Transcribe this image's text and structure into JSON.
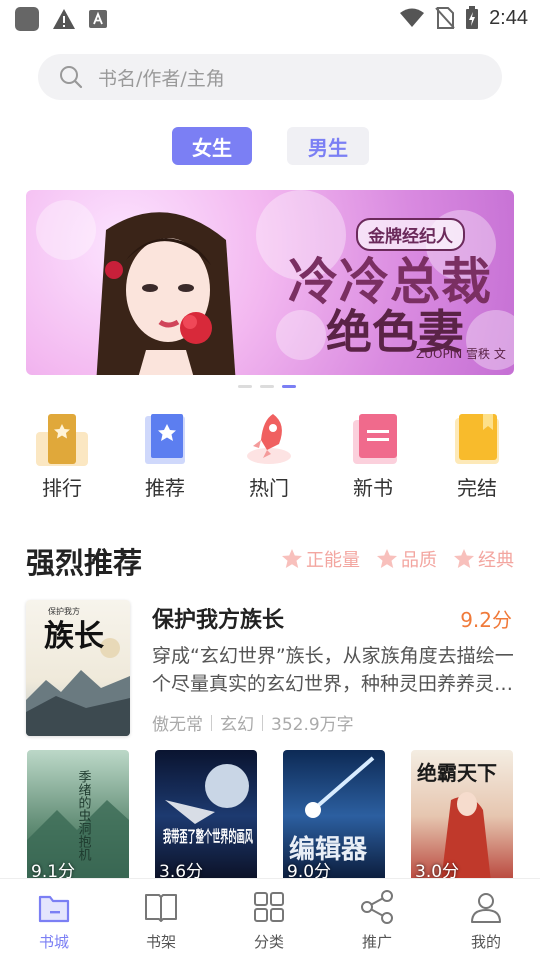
{
  "status_bar": {
    "time": "2:44"
  },
  "search": {
    "placeholder": "书名/作者/主角"
  },
  "tabs": [
    {
      "label": "女生",
      "active": true
    },
    {
      "label": "男生",
      "active": false
    }
  ],
  "banner": {
    "tag": "金牌经纪人",
    "title_line1": "冷冷总裁",
    "title_line2": "绝色妻",
    "author": "ZUOPIN 雪秩 文",
    "page_count": 3,
    "active_page": 3
  },
  "categories": [
    {
      "label": "排行",
      "icon": "ranking-icon"
    },
    {
      "label": "推荐",
      "icon": "recommend-icon"
    },
    {
      "label": "热门",
      "icon": "rocket-icon"
    },
    {
      "label": "新书",
      "icon": "new-book-icon"
    },
    {
      "label": "完结",
      "icon": "finished-icon"
    }
  ],
  "section": {
    "title": "强烈推荐",
    "tags": [
      "正能量",
      "品质",
      "经典"
    ]
  },
  "featured": {
    "title": "保护我方族长",
    "score": "9.2分",
    "description": "穿成“玄幻世界”族长，从家族角度去描绘一个尽量真实的玄幻世界，种种灵田养养灵…",
    "author": "傲无常",
    "genre": "玄幻",
    "word_count": "352.9万字",
    "cover_text": "族长",
    "cover_subtitle": "保护我方"
  },
  "books": [
    {
      "score": "9.1分",
      "cover_text": "季绪的虫洞抱机"
    },
    {
      "score": "3.6分",
      "cover_text": "我带歪了整个世界的画风"
    },
    {
      "score": "9.0分",
      "cover_text": "编辑器"
    },
    {
      "score": "3.0分",
      "cover_text": "绝霸天下"
    }
  ],
  "bottom_nav": [
    {
      "label": "书城",
      "icon": "bookstore-icon",
      "active": true
    },
    {
      "label": "书架",
      "icon": "bookshelf-icon",
      "active": false
    },
    {
      "label": "分类",
      "icon": "category-grid-icon",
      "active": false
    },
    {
      "label": "推广",
      "icon": "share-icon",
      "active": false
    },
    {
      "label": "我的",
      "icon": "profile-icon",
      "active": false
    }
  ],
  "colors": {
    "accent": "#7b7ff4",
    "score": "#f07a3a",
    "tag": "#f3a6a0"
  }
}
